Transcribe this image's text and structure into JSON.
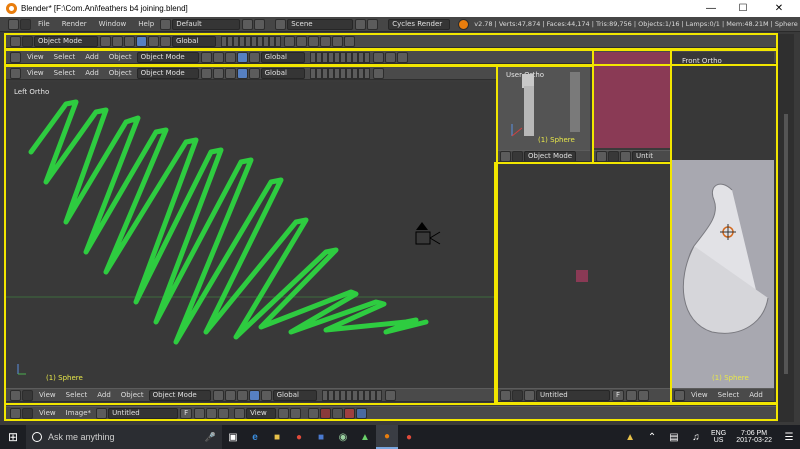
{
  "window": {
    "title": "Blender* [F:\\Com.Ani\\feathers b4 joining.blend]",
    "minimize": "—",
    "maximize": "☐",
    "close": "✕"
  },
  "info_header": {
    "menus": [
      "File",
      "Render",
      "Window",
      "Help"
    ],
    "layout": "Default",
    "scene": "Scene",
    "engine": "Cycles Render",
    "stats": "v2.78 | Verts:47,874 | Faces:44,174 | Tris:89,756 | Objects:1/16 | Lamps:0/1 | Mem:48.21M | Sphere"
  },
  "view3d_header": {
    "mode": "Object Mode",
    "orientation": "Global",
    "menus": [
      "View",
      "Select",
      "Add",
      "Object"
    ]
  },
  "left_view": {
    "label": "Left Ortho",
    "object_name": "(1) Sphere"
  },
  "user_view": {
    "label": "User Ortho",
    "object_name": "(1) Sphere",
    "mode": "Object Mode"
  },
  "front_view": {
    "label": "Front Ortho",
    "object_name": "(1) Sphere",
    "menus": [
      "View",
      "Select",
      "Add"
    ]
  },
  "image_editor": {
    "menus": [
      "View",
      "Image*"
    ],
    "image_name": "Untitled",
    "f_label": "F",
    "view_label": "View"
  },
  "middle_header": {
    "image_name": "Untitled",
    "f_label": "F"
  },
  "small_header": {
    "untitled": "Untit"
  },
  "taskbar": {
    "search_placeholder": "Ask me anything",
    "language": "ENG",
    "region": "US",
    "time": "7:06 PM",
    "date": "2017-03-22"
  },
  "colors": {
    "scribble": "#2ecc40",
    "highlight_frame": "#f2e600",
    "pink_panel": "#8a3a55",
    "viewport_bg": "#393939"
  }
}
